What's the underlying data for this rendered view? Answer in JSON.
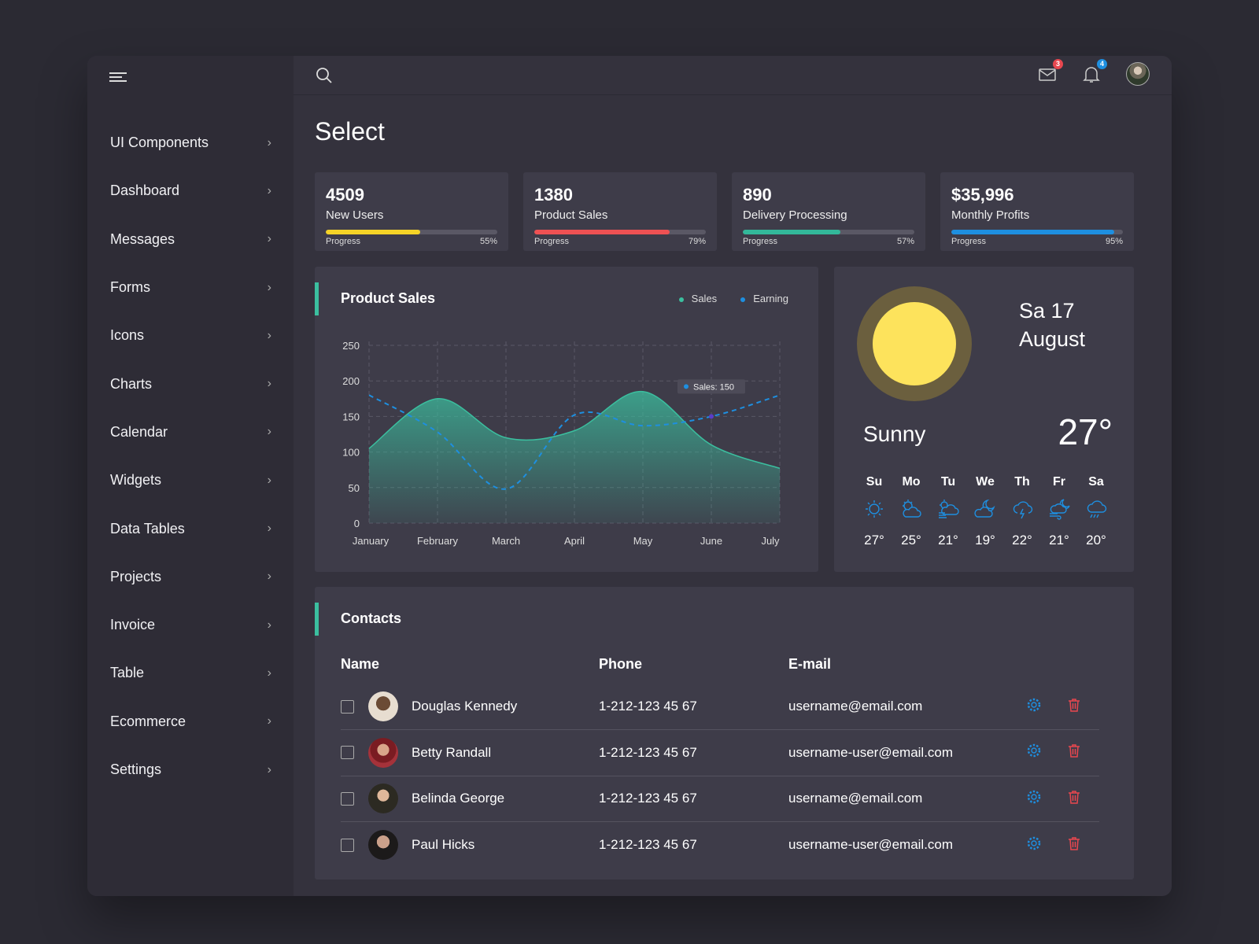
{
  "sidebar": {
    "items": [
      {
        "label": "UI Components"
      },
      {
        "label": "Dashboard"
      },
      {
        "label": "Messages"
      },
      {
        "label": "Forms"
      },
      {
        "label": "Icons"
      },
      {
        "label": "Charts"
      },
      {
        "label": "Calendar"
      },
      {
        "label": "Widgets"
      },
      {
        "label": "Data Tables"
      },
      {
        "label": "Projects"
      },
      {
        "label": "Invoice"
      },
      {
        "label": "Table"
      },
      {
        "label": "Ecommerce"
      },
      {
        "label": "Settings"
      }
    ]
  },
  "header": {
    "mail_badge": "3",
    "bell_badge": "4",
    "mail_badge_color": "#e8474f",
    "bell_badge_color": "#1e8fe0"
  },
  "page_title": "Select",
  "stats": [
    {
      "value": "4509",
      "label": "New Users",
      "progress_label": "Progress",
      "percent": "55%",
      "fill": 55,
      "color": "#f5d327"
    },
    {
      "value": "1380",
      "label": "Product Sales",
      "progress_label": "Progress",
      "percent": "79%",
      "fill": 79,
      "color": "#ee5153"
    },
    {
      "value": "890",
      "label": "Delivery Processing",
      "progress_label": "Progress",
      "percent": "57%",
      "fill": 57,
      "color": "#33b89a"
    },
    {
      "value": "$35,996",
      "label": "Monthly Profits",
      "progress_label": "Progress",
      "percent": "95%",
      "fill": 95,
      "color": "#1e8fe0"
    }
  ],
  "chart_data": {
    "type": "area",
    "title": "Product Sales",
    "categories": [
      "January",
      "February",
      "March",
      "April",
      "May",
      "June",
      "July"
    ],
    "ylim": [
      0,
      250
    ],
    "yticks": [
      0,
      50,
      100,
      150,
      200,
      250
    ],
    "grid": true,
    "legend_position": "top-right",
    "series": [
      {
        "name": "Sales",
        "values": [
          105,
          175,
          120,
          130,
          185,
          110,
          77
        ],
        "color": "#3bbf9f",
        "style": "area"
      },
      {
        "name": "Earning",
        "values": [
          180,
          128,
          48,
          152,
          137,
          150,
          180
        ],
        "color": "#1e8fe0",
        "style": "dashed-line"
      }
    ],
    "tooltip": "Sales: 150"
  },
  "weather": {
    "date_line1": "Sa 17",
    "date_line2": "August",
    "condition": "Sunny",
    "temperature": "27°",
    "days": [
      {
        "name": "Su",
        "icon": "sun-icon",
        "temp": "27°"
      },
      {
        "name": "Mo",
        "icon": "partly-cloudy-icon",
        "temp": "25°"
      },
      {
        "name": "Tu",
        "icon": "cloudy-wind-icon",
        "temp": "21°"
      },
      {
        "name": "We",
        "icon": "cloud-moon-icon",
        "temp": "19°"
      },
      {
        "name": "Th",
        "icon": "thunderstorm-icon",
        "temp": "22°"
      },
      {
        "name": "Fr",
        "icon": "night-wind-icon",
        "temp": "21°"
      },
      {
        "name": "Sa",
        "icon": "rain-icon",
        "temp": "20°"
      }
    ]
  },
  "contacts": {
    "title": "Contacts",
    "headers": {
      "name": "Name",
      "phone": "Phone",
      "email": "E-mail"
    },
    "rows": [
      {
        "name": "Douglas Kennedy",
        "phone": "1-212-123 45 67",
        "email": "username@email.com"
      },
      {
        "name": "Betty Randall",
        "phone": "1-212-123 45 67",
        "email": "username-user@email.com"
      },
      {
        "name": "Belinda George",
        "phone": "1-212-123 45 67",
        "email": "username@email.com"
      },
      {
        "name": "Paul Hicks",
        "phone": "1-212-123 45 67",
        "email": "username-user@email.com"
      }
    ]
  }
}
